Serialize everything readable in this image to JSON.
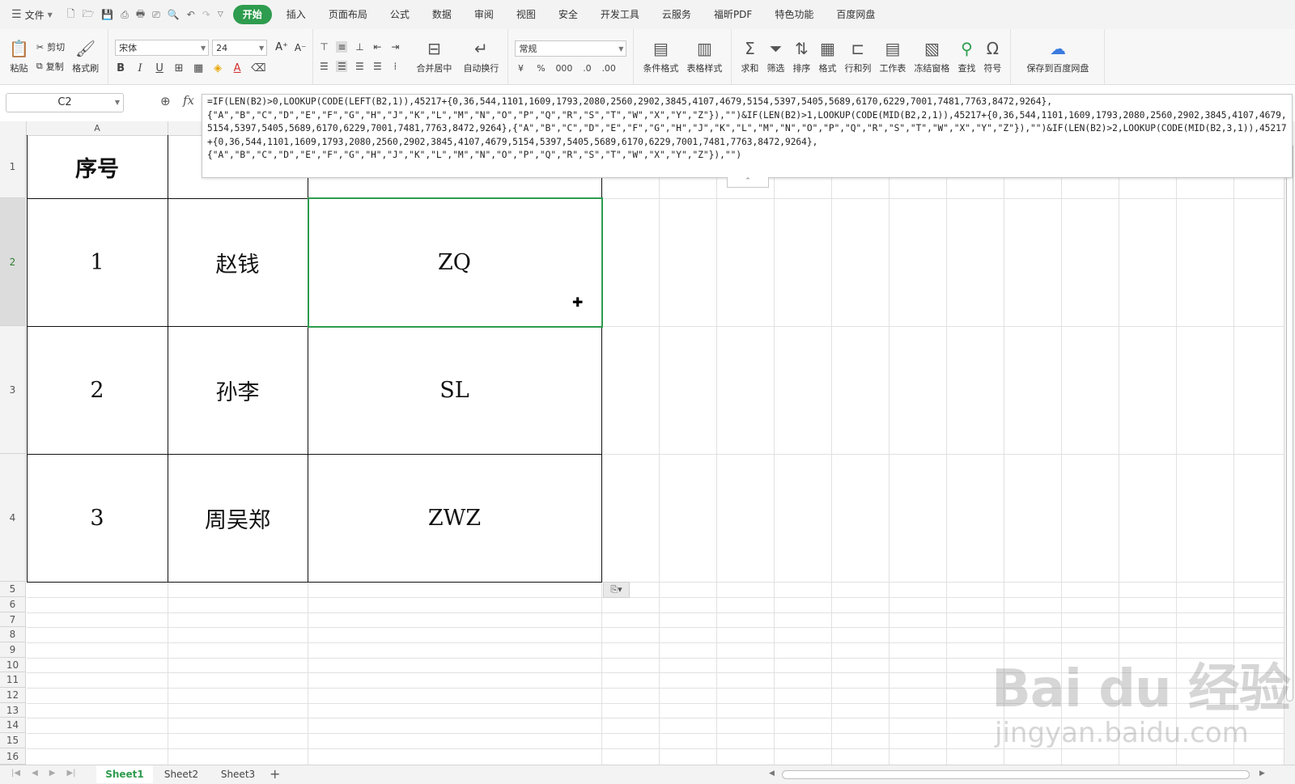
{
  "menu": {
    "file": "文件",
    "tabs": [
      "开始",
      "插入",
      "页面布局",
      "公式",
      "数据",
      "审阅",
      "视图",
      "安全",
      "开发工具",
      "云服务",
      "福昕PDF",
      "特色功能",
      "百度网盘"
    ],
    "active_tab": "开始"
  },
  "ribbon": {
    "paste": "粘贴",
    "cut": "剪切",
    "copy": "复制",
    "format_painter": "格式刷",
    "font_name": "宋体",
    "font_size": "24",
    "merge_center": "合并居中",
    "wrap_text": "自动换行",
    "number_format": "常规",
    "conditional_format": "条件格式",
    "table_style": "表格样式",
    "sum": "求和",
    "filter": "筛选",
    "sort": "排序",
    "format": "格式",
    "row_col": "行和列",
    "worksheet": "工作表",
    "freeze": "冻结窗格",
    "find": "查找",
    "symbol": "符号",
    "save_baidu": "保存到百度网盘"
  },
  "formula_bar": {
    "name_box": "C2",
    "fx_label": "fx",
    "formula": "=IF(LEN(B2)>0,LOOKUP(CODE(LEFT(B2,1)),45217+{0,36,544,1101,1609,1793,2080,2560,2902,3845,4107,4679,5154,5397,5405,5689,6170,6229,7001,7481,7763,8472,9264},{\"A\",\"B\",\"C\",\"D\",\"E\",\"F\",\"G\",\"H\",\"J\",\"K\",\"L\",\"M\",\"N\",\"O\",\"P\",\"Q\",\"R\",\"S\",\"T\",\"W\",\"X\",\"Y\",\"Z\"}),\"\")&IF(LEN(B2)>1,LOOKUP(CODE(MID(B2,2,1)),45217+{0,36,544,1101,1609,1793,2080,2560,2902,3845,4107,4679,5154,5397,5405,5689,6170,6229,7001,7481,7763,8472,9264},{\"A\",\"B\",\"C\",\"D\",\"E\",\"F\",\"G\",\"H\",\"J\",\"K\",\"L\",\"M\",\"N\",\"O\",\"P\",\"Q\",\"R\",\"S\",\"T\",\"W\",\"X\",\"Y\",\"Z\"}),\"\")&IF(LEN(B2)>2,LOOKUP(CODE(MID(B2,3,1)),45217+{0,36,544,1101,1609,1793,2080,2560,2902,3845,4107,4679,5154,5397,5405,5689,6170,6229,7001,7481,7763,8472,9264},{\"A\",\"B\",\"C\",\"D\",\"E\",\"F\",\"G\",\"H\",\"J\",\"K\",\"L\",\"M\",\"N\",\"O\",\"P\",\"Q\",\"R\",\"S\",\"T\",\"W\",\"X\",\"Y\",\"Z\"}),\"\")"
  },
  "sheet": {
    "column_a": "A",
    "row_numbers": [
      "1",
      "2",
      "3",
      "4",
      "5",
      "6",
      "7",
      "8",
      "9",
      "10",
      "11",
      "12",
      "13",
      "14",
      "15",
      "16"
    ],
    "header": "序号",
    "rows": [
      {
        "no": "1",
        "name": "赵钱",
        "initials": "ZQ"
      },
      {
        "no": "2",
        "name": "孙李",
        "initials": "SL"
      },
      {
        "no": "3",
        "name": "周吴郑",
        "initials": "ZWZ"
      }
    ]
  },
  "sheet_tabs": [
    "Sheet1",
    "Sheet2",
    "Sheet3"
  ],
  "active_sheet": "Sheet1",
  "watermark": {
    "brand": "Bai du 经验",
    "url": "jingyan.baidu.com"
  },
  "colors": {
    "accent": "#2e9c4e"
  }
}
